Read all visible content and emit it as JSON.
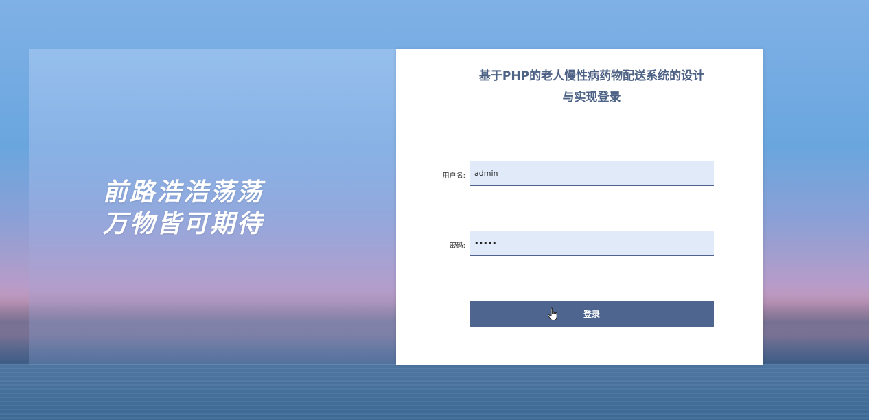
{
  "slogan": {
    "line1": "前路浩浩荡荡",
    "line2": "万物皆可期待"
  },
  "login": {
    "title_line1": "基于PHP的老人慢性病药物配送系统的设计",
    "title_line2": "与实现登录",
    "username_label": "用户名:",
    "username_value": "admin",
    "password_label": "密码:",
    "password_value": "•••••",
    "submit_label": "登录"
  },
  "colors": {
    "accent": "#4e6590",
    "title": "#4d6285",
    "input_bg": "#e0eaf8"
  },
  "icons": {
    "pointer": "hand-pointer-icon"
  }
}
